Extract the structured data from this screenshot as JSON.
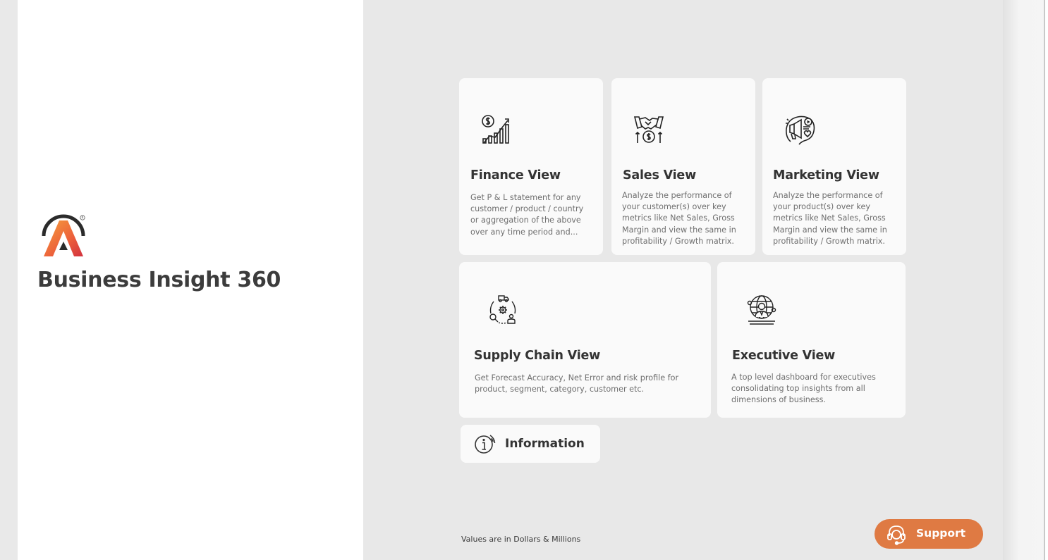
{
  "app": {
    "title": "Business Insight 360",
    "brand_colors": {
      "logo_dark": "#2b2b2b",
      "logo_orange": "#f08a3c",
      "logo_red": "#d9363e",
      "accent": "#df7a43"
    }
  },
  "cards": [
    {
      "id": "finance",
      "title": "Finance View",
      "icon": "finance-growth-icon",
      "description": "Get P & L statement for any customer / product / country or aggregation of the above over any time period and..."
    },
    {
      "id": "sales",
      "title": "Sales View",
      "icon": "handshake-dollar-icon",
      "description": "Analyze the performance of your customer(s) over key metrics like Net Sales, Gross Margin and view the same in profitability / Growth matrix."
    },
    {
      "id": "marketing",
      "title": "Marketing View",
      "icon": "marketing-megaphone-icon",
      "description": "Analyze the performance of your product(s) over key metrics like Net Sales, Gross Margin and view the same in profitability / Growth matrix."
    },
    {
      "id": "supply_chain",
      "title": "Supply Chain View",
      "icon": "supply-chain-cycle-icon",
      "description": "Get Forecast Accuracy, Net Error and risk profile for product, segment, category, customer etc."
    },
    {
      "id": "executive",
      "title": "Executive View",
      "icon": "globe-executive-icon",
      "description": "A top level dashboard for executives consolidating top insights from all dimensions of business."
    }
  ],
  "information": {
    "label": "Information",
    "icon": "info-icon"
  },
  "footer": {
    "note": "Values are in Dollars & Millions"
  },
  "support": {
    "label": "Support",
    "icon": "headset-icon",
    "color": "#df7a43"
  }
}
